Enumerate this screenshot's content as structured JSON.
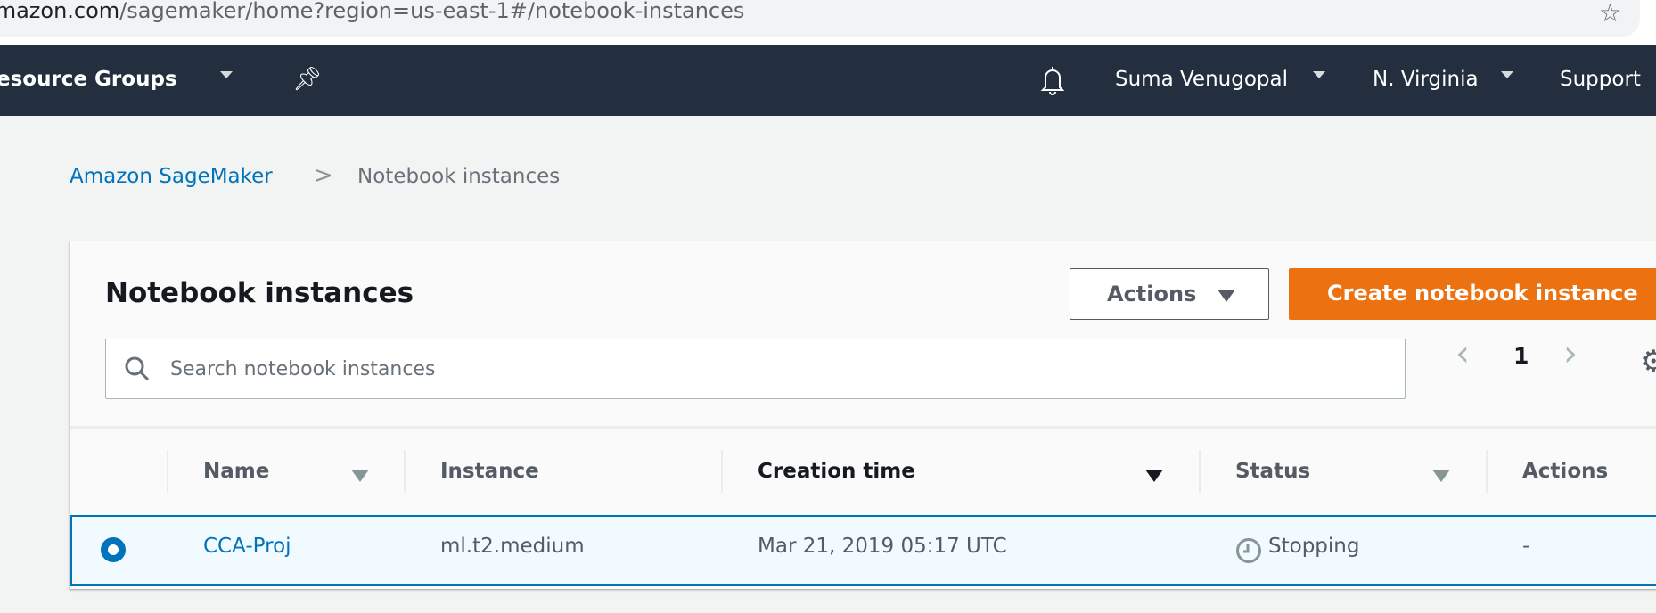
{
  "browser": {
    "url_domain": "amazon.com",
    "url_path": "/sagemaker/home?region=us-east-1#/notebook-instances",
    "icons": [
      "star-icon"
    ]
  },
  "nav": {
    "resource_groups": "esource Groups",
    "user": "Suma Venugopal",
    "region": "N. Virginia",
    "support": "Support",
    "icons": [
      "pin-icon",
      "bell-icon"
    ]
  },
  "breadcrumb": {
    "root": "Amazon SageMaker",
    "current": "Notebook instances",
    "separator": ">"
  },
  "panel": {
    "title": "Notebook instances",
    "actions_label": "Actions",
    "create_label": "Create notebook instance",
    "search_placeholder": "Search notebook instances",
    "page": "1"
  },
  "table": {
    "columns": [
      "Name",
      "Instance",
      "Creation time",
      "Status",
      "Actions"
    ],
    "sorted_column": "Creation time",
    "rows": [
      {
        "selected": true,
        "name": "CCA-Proj",
        "instance": "ml.t2.medium",
        "creation_time": "Mar 21, 2019 05:17 UTC",
        "status": "Stopping",
        "actions": "-"
      }
    ]
  },
  "colors": {
    "nav_bg": "#232f3e",
    "accent": "#ec7211",
    "link": "#0073bb",
    "selected_row_bg": "#f1faff"
  }
}
